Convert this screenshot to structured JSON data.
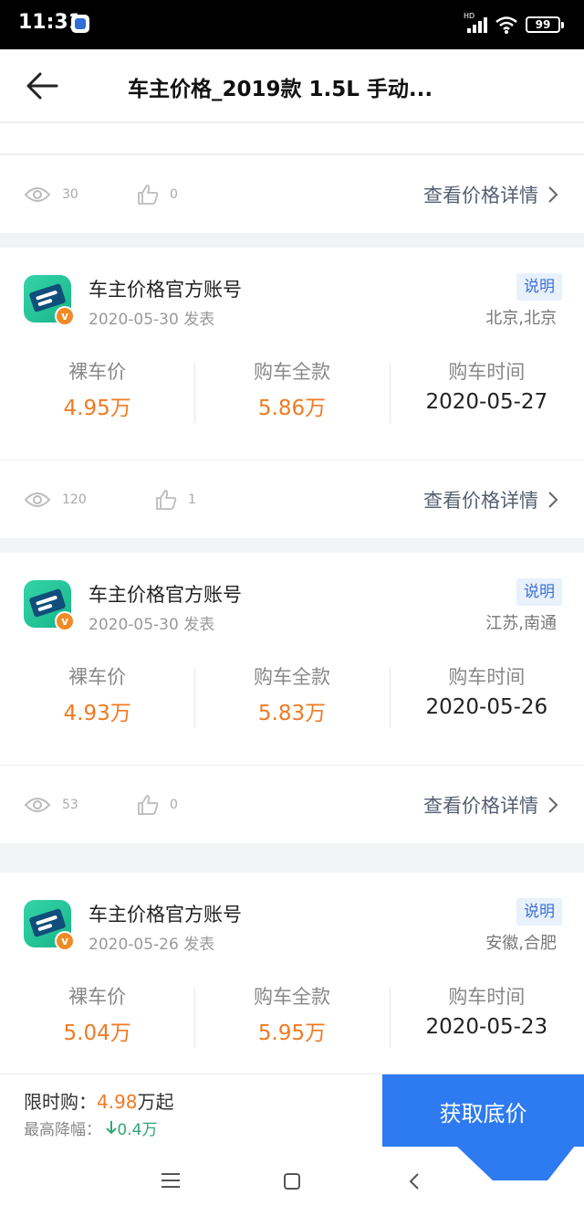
{
  "status_bar": {
    "time": "11:31",
    "network": "HD",
    "battery": "99"
  },
  "header": {
    "title": "车主价格_2019款 1.5L 手动..."
  },
  "detail_link_label": "查看价格详情",
  "price_labels": {
    "bare": "裸车价",
    "full": "购车全款",
    "time": "购车时间"
  },
  "top_stats": {
    "views": "30",
    "likes": "0"
  },
  "posts": [
    {
      "author": "车主价格官方账号",
      "date": "2020-05-30 发表",
      "tag": "说明",
      "location": "北京,北京",
      "bare_price": "4.95万",
      "full_price": "5.86万",
      "purchase_date": "2020-05-27",
      "views": "120",
      "likes": "1"
    },
    {
      "author": "车主价格官方账号",
      "date": "2020-05-30 发表",
      "tag": "说明",
      "location": "江苏,南通",
      "bare_price": "4.93万",
      "full_price": "5.83万",
      "purchase_date": "2020-05-26",
      "views": "53",
      "likes": "0"
    },
    {
      "author": "车主价格官方账号",
      "date": "2020-05-26 发表",
      "tag": "说明",
      "location": "安徽,合肥",
      "bare_price": "5.04万",
      "full_price": "5.95万",
      "purchase_date": "2020-05-23"
    }
  ],
  "bottom_bar": {
    "promo_label": "限时购：",
    "promo_price": "4.98",
    "promo_suffix": "万起",
    "drop_label": "最高降幅：",
    "drop_value": "0.4万",
    "cta_label": "获取底价"
  },
  "colors": {
    "accent_blue": "#2e7af0",
    "price_orange": "#f07a22",
    "drop_green": "#2fa774"
  }
}
